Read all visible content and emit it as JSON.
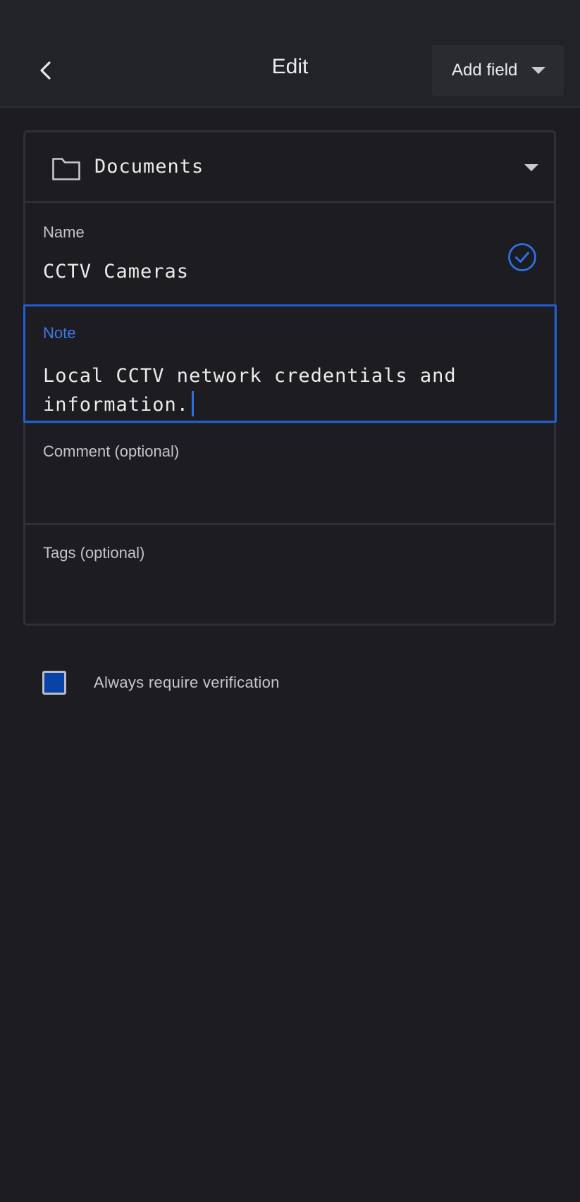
{
  "header": {
    "title": "Edit",
    "back_icon": "chevron-left-icon",
    "add_field_label": "Add field"
  },
  "form": {
    "folder": {
      "icon": "folder-icon",
      "name": "Documents"
    },
    "name": {
      "label": "Name",
      "value": "CCTV Cameras",
      "status_icon": "check-circle-icon"
    },
    "note": {
      "label": "Note",
      "line1": "Local CCTV network credentials and",
      "line2": "information."
    },
    "comment": {
      "label": "Comment (optional)",
      "value": ""
    },
    "tags": {
      "label": "Tags (optional)",
      "value": ""
    }
  },
  "verification": {
    "label": "Always require verification",
    "checked": true
  },
  "colors": {
    "background": "#1c1c21",
    "accent": "#1f5fd3",
    "checkbox_fill": "#0a43a8"
  }
}
